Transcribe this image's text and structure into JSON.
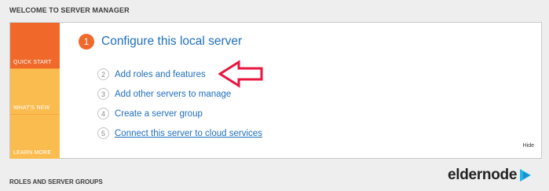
{
  "header": {
    "title": "WELCOME TO SERVER MANAGER"
  },
  "sidebar": {
    "items": [
      {
        "label": "QUICK START"
      },
      {
        "label": "WHAT'S NEW"
      },
      {
        "label": "LEARN MORE"
      }
    ]
  },
  "step1": {
    "number": "1",
    "title": "Configure this local server"
  },
  "tasks": [
    {
      "number": "2",
      "label": "Add roles and features"
    },
    {
      "number": "3",
      "label": "Add other servers to manage"
    },
    {
      "number": "4",
      "label": "Create a server group"
    },
    {
      "number": "5",
      "label": "Connect this server to cloud services"
    }
  ],
  "hide_label": "Hide",
  "footer": {
    "title": "ROLES AND SERVER GROUPS"
  },
  "watermark": {
    "text": "eldernode"
  },
  "colors": {
    "accent_orange": "#f1692a",
    "sidebar_yellow": "#fbbc4f",
    "link_blue": "#1f6fbe",
    "arrow_red": "#e8163f",
    "logo_cyan": "#1fb6e6"
  }
}
